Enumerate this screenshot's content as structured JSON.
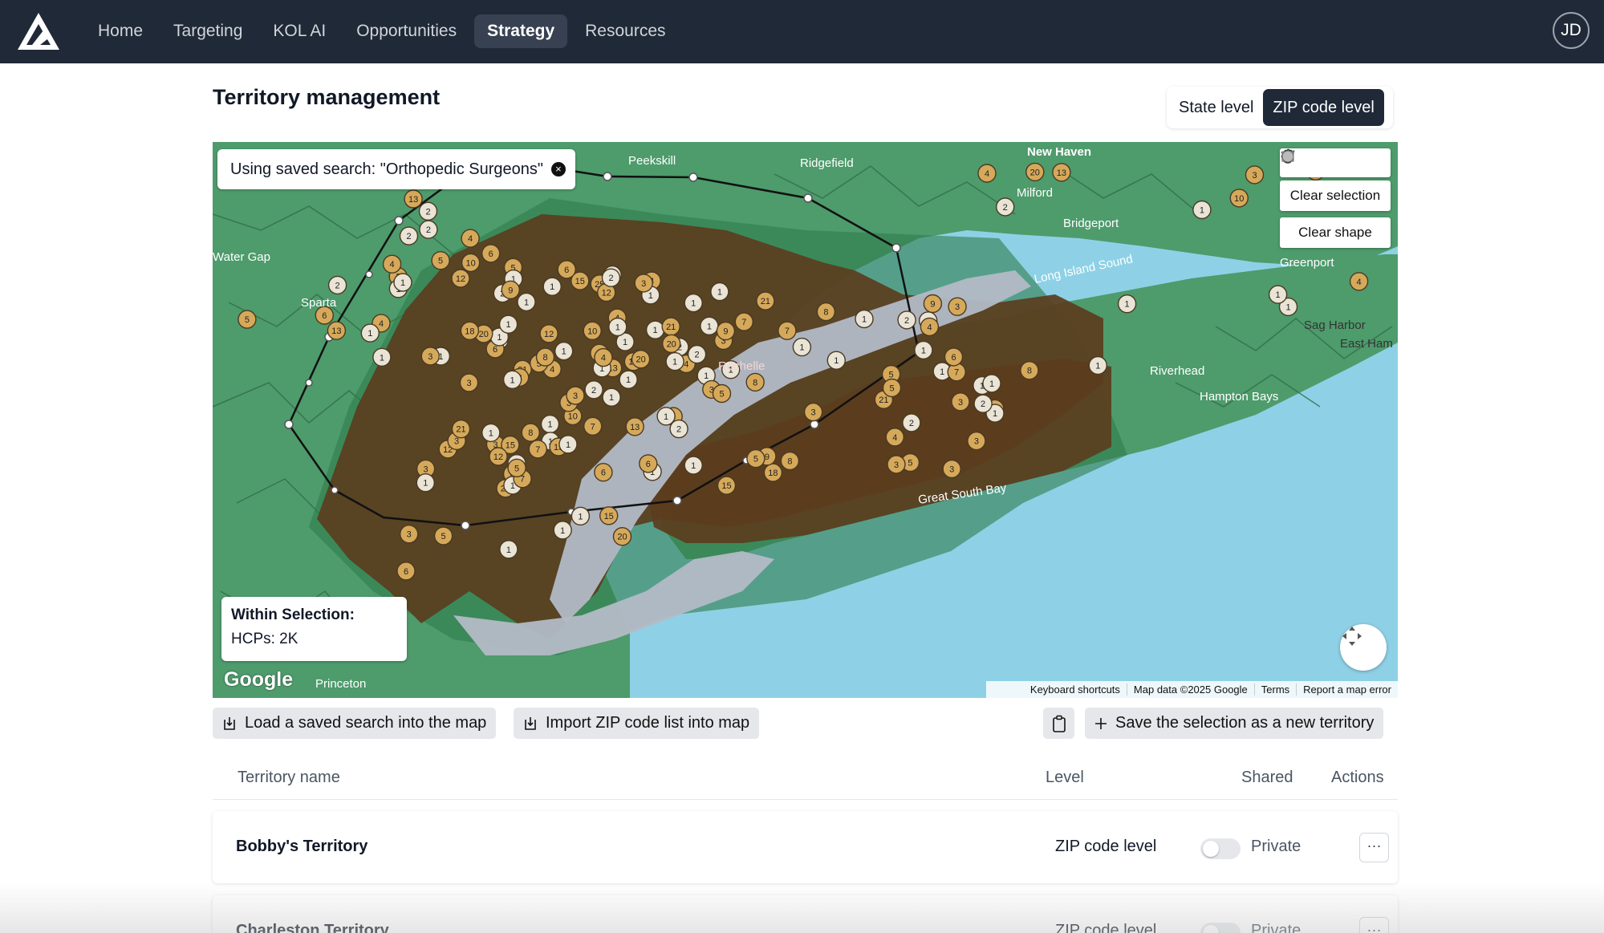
{
  "nav": {
    "items": [
      {
        "label": "Home",
        "active": false
      },
      {
        "label": "Targeting",
        "active": false
      },
      {
        "label": "KOL AI",
        "active": false
      },
      {
        "label": "Opportunities",
        "active": false
      },
      {
        "label": "Strategy",
        "active": true
      },
      {
        "label": "Resources",
        "active": false
      }
    ],
    "avatar_initials": "JD"
  },
  "page": {
    "title": "Territory management",
    "level_options": [
      {
        "label": "State level",
        "active": false
      },
      {
        "label": "ZIP code level",
        "active": true
      }
    ]
  },
  "map": {
    "saved_search_chip": "Using saved search: \"Orthopedic Surgeons\"",
    "draw_tools": [
      "hand-icon",
      "polygon-icon",
      "rectangle-icon",
      "circle-icon"
    ],
    "clear_selection": "Clear selection",
    "clear_shape": "Clear shape",
    "within_selection_title": "Within Selection:",
    "within_selection_value": "HCPs: 2K",
    "google_logo": "Google",
    "attribution": [
      "Keyboard shortcuts",
      "Map data ©2025 Google",
      "Terms",
      "Report a map error"
    ],
    "place_labels": [
      "Peekskill",
      "Ridgefield",
      "New Haven",
      "Milford",
      "Bridgeport",
      "Long Island Sound",
      "Greenport",
      "Sag Harbor",
      "East Ham",
      "Riverhead",
      "Hampton Bays",
      "Great South Bay",
      "Sparta",
      "Water Gap",
      "Princeton",
      "Rochelle"
    ],
    "colors": {
      "water": "#8ed1e6",
      "land": "#4a9a6a",
      "selection": "#5b3d1e",
      "marker": "#d6a95a"
    }
  },
  "actions": {
    "load_saved_search": "Load a saved search into the map",
    "import_zip": "Import ZIP code list into map",
    "save_selection": "Save the selection as a new territory"
  },
  "table": {
    "headers": {
      "name": "Territory name",
      "level": "Level",
      "shared": "Shared",
      "actions": "Actions"
    },
    "rows": [
      {
        "name": "Bobby's Territory",
        "level": "ZIP code level",
        "shared": "Private",
        "actions": "···"
      },
      {
        "name": "Charleston Territory",
        "level": "ZIP code level",
        "shared": "Private",
        "actions": "···"
      }
    ]
  }
}
